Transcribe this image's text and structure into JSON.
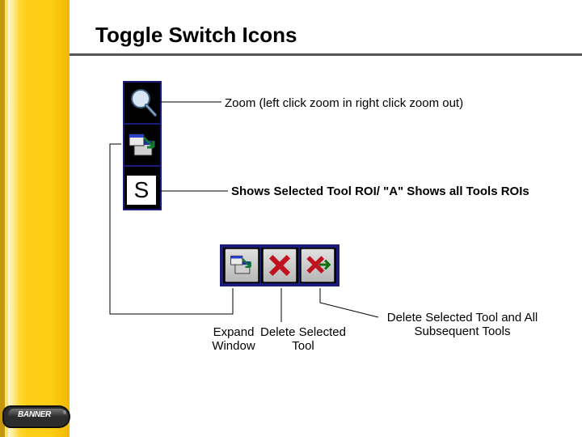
{
  "heading": "Toggle Switch Icons",
  "annotations": {
    "zoom": "Zoom (left click zoom in right click zoom out)",
    "selected": "Shows Selected Tool ROI/ \"A\" Shows all Tools ROIs",
    "expand": "Expand Window",
    "delete": "Delete Selected Tool",
    "deleteAfter": "Delete Selected Tool and All Subsequent Tools"
  },
  "icons": {
    "selected_letter": "S"
  },
  "logo": {
    "text": "BANNER",
    "reg": "®"
  },
  "colors": {
    "sidebar": "#fecd15",
    "toolbar_border": "#1b1b7a"
  }
}
